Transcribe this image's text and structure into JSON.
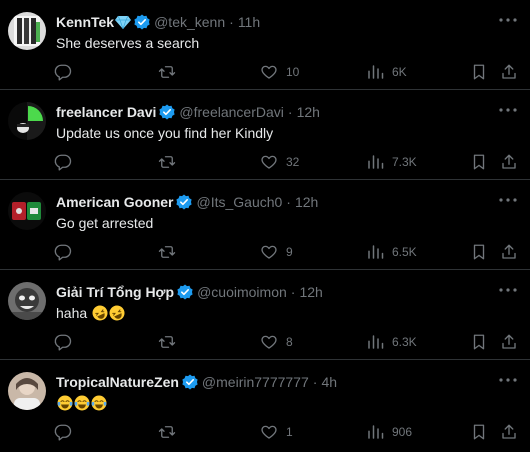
{
  "colors": {
    "background": "#000000",
    "text": "#e7e9ea",
    "muted": "#71767b",
    "verified": "#1d9bf0",
    "divider": "#2f3336"
  },
  "tweets": [
    {
      "name": "KennTek",
      "badge": "gem-icon",
      "verified": true,
      "handle": "@tek_kenn",
      "time": "11h",
      "text": "She deserves a search",
      "emojis": [],
      "likes": "10",
      "views": "6K"
    },
    {
      "name": "freelancer Davi",
      "verified": true,
      "handle": "@freelancerDavi",
      "time": "12h",
      "text": "Update us once you find her Kindly",
      "emojis": [],
      "likes": "32",
      "views": "7.3K"
    },
    {
      "name": "American Gooner",
      "verified": true,
      "handle": "@Its_Gauch0",
      "time": "12h",
      "text": "Go get arrested",
      "emojis": [],
      "likes": "9",
      "views": "6.5K"
    },
    {
      "name": "Giải Trí Tổng Hợp",
      "verified": true,
      "handle": "@cuoimoimon",
      "time": "12h",
      "text": "haha",
      "emojis": [
        "rolling-laughing-emoji",
        "rolling-laughing-emoji"
      ],
      "likes": "8",
      "views": "6.3K"
    },
    {
      "name": "TropicalNatureZen",
      "verified": true,
      "handle": "@meirin7777777",
      "time": "4h",
      "text": "",
      "emojis": [
        "tears-of-joy-emoji",
        "tears-of-joy-emoji",
        "tears-of-joy-emoji"
      ],
      "likes": "1",
      "views": "906"
    }
  ],
  "icons": {
    "reply": "reply-icon",
    "retweet": "retweet-icon",
    "like": "heart-icon",
    "views": "views-icon",
    "bookmark": "bookmark-icon",
    "share": "share-icon",
    "more": "more-icon"
  }
}
